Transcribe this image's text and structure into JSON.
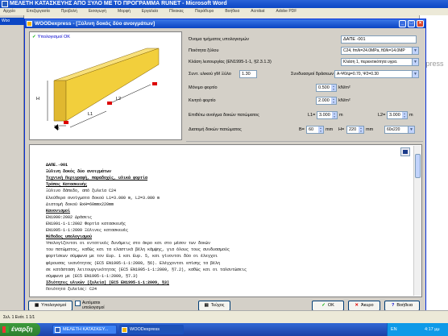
{
  "word_window": {
    "title": "ΜΕΛΕΤΗ ΚΑΤΑΣΚΕΥΗΣ ΑΠΟ ΞΥΛΟ ΜΕ ΤΟ ΠΡΟΓΡΑΜΜΑ RUNET - Microsoft Word",
    "menu": [
      "Αρχείο",
      "Επεξεργασία",
      "Προβολή",
      "Εισαγωγή",
      "Μορφή",
      "Εργαλεία",
      "Πίνακας",
      "Παράθυρο",
      "Βοήθεια",
      "Acrobat",
      "Adobe PDF"
    ],
    "right_fragment": "xpress",
    "left_mini_title": "Woo"
  },
  "dialog": {
    "title": "WOODexpress - [Ξύλινη δοκός δύο ανοιγμάτων]",
    "ok_label": "Υπολογισμοί ΟΚ",
    "preview_labels": {
      "h": "H",
      "l1": "L1",
      "l2": "L2",
      "b": "B"
    },
    "fields": {
      "name_label": "Όνομα τμήματος υπολογισμών",
      "name_value": "ΔΑΠΕ -001",
      "wood_label": "Ποιότητα ξύλου",
      "wood_value": "C24, fm/k=24.0MPa, ft0/k=14.0MP",
      "service_label": "Κλάση λειτουργίας (EN1995-1-1, §2.3.1.3)",
      "service_value": "Κλάση 1, περιεκτικότητα υγρα.",
      "gamma_label": "Συντ. υλικού γM Ξύλο",
      "gamma_value": "1.30",
      "combo_label": "Συνδυασμοί δράσεων",
      "combo_value": "A-Ψ0/ψ=0.70, Ψ2=0.30",
      "perm_label": "Μόνιμο φορτίο",
      "perm_value": "0.500",
      "perm_unit": "kN/m²",
      "live_label": "Κινητό φορτίο",
      "live_value": "2.000",
      "live_unit": "kN/m²",
      "span_label": "Επιθέτω ανοίγμα δοκών πατώματος",
      "l1_label": "L1=",
      "l1_value": "3.000",
      "l1_unit": "m",
      "l2_label": "L2=",
      "l2_value": "3.000",
      "l2_unit": "m",
      "dims_label": "Διατομή δοκών πατώματος",
      "b_label": "B=",
      "b_value": "60",
      "b_unit": "mm",
      "h_label": "H=",
      "h_value": "220",
      "h_unit": "mm",
      "section_value": "60x220"
    },
    "report": {
      "lines": [
        {
          "text": "ΔΑΠΕ.-001",
          "style": "rb"
        },
        {
          "text": "Ξύλινη δοκός δύο ανοιγμάτων",
          "style": "rb"
        },
        {
          "text": "Τεχνική Περιγραφή, παραδοχές, υλικά φορτία",
          "style": "ru"
        },
        {
          "text": "Τρόπος Κατασκευής",
          "style": "ru"
        },
        {
          "text": "Ξύλινο δάπεδο, από ξυλεία  C24",
          "style": ""
        },
        {
          "text": "Ελεύθερα ανοίγματα δοκού L1=3.000 m, L2=3.000 m",
          "style": ""
        },
        {
          "text": "Διατομή δοκού ΒxΗ=60mmx220mm",
          "style": ""
        },
        {
          "text": "Κανονισμοί",
          "style": "ru"
        },
        {
          "text": "EN1990:2002 Δράσεις",
          "style": ""
        },
        {
          "text": "EN1991-1-1:2002 Φορτία κατασκευής",
          "style": ""
        },
        {
          "text": "EN1995-1-1:2009 Ξύλινες κατασκευές",
          "style": ""
        },
        {
          "text": "Μέθοδος υπολογισμού",
          "style": "ru"
        },
        {
          "text": "Υπολογίζονται οι εντατικές δυνάμεις στο άκρο και στο μέσον των δοκών",
          "style": ""
        },
        {
          "text": "του πατώματος, καθώς και τα ελαστικά βέλη κάμψης, για όλους τους συνδυασμούς",
          "style": ""
        },
        {
          "text": "φορτίσεων σύμφωνα με τον Ευρ. 1 και Ευρ. 5, και γίνονται δύο οι έλεγχοι",
          "style": ""
        },
        {
          "text": "φέρουσας ικανότητας (EC5 EN1995-1-1:2009, §6). Ελέγχονται επίσης τα βέλη",
          "style": ""
        },
        {
          "text": "σε κατάσταση λειτουργικότητας (EC5 EN1995-1-1:2009, §7.2), καθώς και οι ταλαντώσεις",
          "style": ""
        },
        {
          "text": "σύμφωνα με (EC5 EN1995-1-1:2009, §7.3)",
          "style": ""
        },
        {
          "text": "Ιδιότητες υλικών (ξυλεία) (EC5 EN1995-1-1:2009, §3)",
          "style": "ru"
        },
        {
          "text": "Ποιότητα ξυλείας:  C24",
          "style": ""
        }
      ]
    },
    "buttons": {
      "calc": "Υπολογισμοί",
      "auto": "Αυτόματοι υπολογισμοί",
      "text": "Τεύχος",
      "ok": "OK",
      "cancel": "Άκυρο",
      "help": "Βοήθεια"
    }
  },
  "status": {
    "text": "Σελ. 1  Ενότ. 1  1/1"
  },
  "taskbar": {
    "start": "έναρξη",
    "tasks": [
      "ΜΕΛΕΤΗ ΚΑΤΑΣΚΕΥ...",
      "WOODexpress"
    ],
    "lang": "EN",
    "time": "4:17 μμ"
  },
  "colors": {
    "beam": "#f2cf3c",
    "accent": "#0a44c2",
    "taskbar": "#245edb"
  }
}
